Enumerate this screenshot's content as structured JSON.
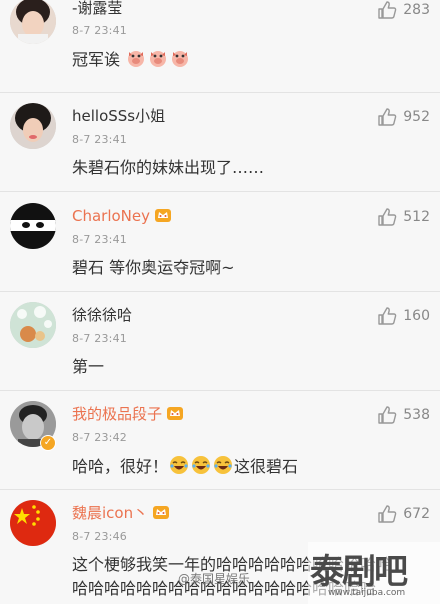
{
  "comments": [
    {
      "name": "-谢露莹",
      "time": "8-7 23:41",
      "text": "冠军诶",
      "likes": "283"
    },
    {
      "name": "helloSSs小姐",
      "time": "8-7 23:41",
      "text": "朱碧石你的妹妹出现了……",
      "likes": "952"
    },
    {
      "name": "CharloNey",
      "time": "8-7 23:41",
      "text": "碧石 等你奥运夺冠啊~",
      "likes": "512"
    },
    {
      "name": "徐徐徐哈",
      "time": "8-7 23:41",
      "text": "第一",
      "likes": "160"
    },
    {
      "name": "我的极品段子",
      "time": "8-7 23:42",
      "text_a": "哈哈，很好！",
      "text_b": "这很碧石",
      "likes": "538"
    },
    {
      "name": "魏晨icon丶",
      "time": "8-7 23:46",
      "text_line1": "这个梗够我笑一年的哈哈哈哈哈哈哈哈哈哈哈",
      "text_line2": "哈哈哈哈哈哈哈哈哈哈哈哈哈哈哈哈哈哈哈",
      "likes": "672"
    }
  ],
  "watermark": {
    "logo": "泰剧吧",
    "url": "www.taijuba.com",
    "weibo": "@泰国星娱乐"
  },
  "colors": {
    "vip_name": "#eb7350",
    "badge": "#f5a623"
  }
}
